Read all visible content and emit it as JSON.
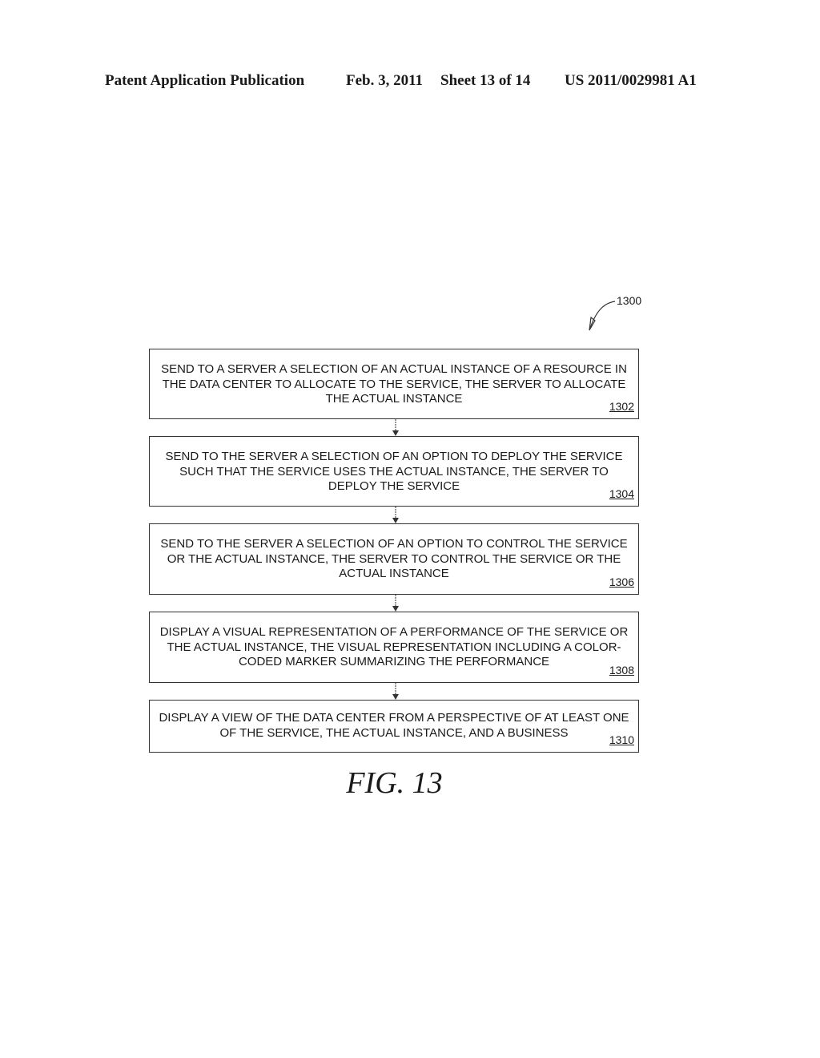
{
  "header": {
    "publication": "Patent Application Publication",
    "date": "Feb. 3, 2011",
    "sheet": "Sheet 13 of 14",
    "number": "US 2011/0029981 A1"
  },
  "diagram": {
    "ref": "1300",
    "steps": [
      {
        "text": "SEND TO A SERVER A SELECTION OF AN ACTUAL INSTANCE OF A RESOURCE IN THE DATA CENTER TO ALLOCATE TO THE SERVICE, THE SERVER TO ALLOCATE THE ACTUAL INSTANCE",
        "num": "1302"
      },
      {
        "text": "SEND TO THE SERVER A SELECTION OF AN OPTION TO DEPLOY THE SERVICE SUCH THAT THE SERVICE USES THE ACTUAL INSTANCE, THE SERVER TO DEPLOY THE SERVICE",
        "num": "1304"
      },
      {
        "text": "SEND TO THE SERVER A SELECTION OF AN OPTION TO CONTROL THE SERVICE OR THE ACTUAL INSTANCE, THE SERVER TO CONTROL THE SERVICE OR THE ACTUAL INSTANCE",
        "num": "1306"
      },
      {
        "text": "DISPLAY A VISUAL REPRESENTATION OF A PERFORMANCE OF THE SERVICE OR THE ACTUAL INSTANCE, THE VISUAL REPRESENTATION INCLUDING A COLOR-CODED MARKER SUMMARIZING THE PERFORMANCE",
        "num": "1308"
      },
      {
        "text": "DISPLAY A VIEW OF THE DATA CENTER FROM A PERSPECTIVE OF AT LEAST ONE OF THE SERVICE, THE ACTUAL INSTANCE, AND A BUSINESS",
        "num": "1310"
      }
    ],
    "caption": "FIG. 13"
  }
}
